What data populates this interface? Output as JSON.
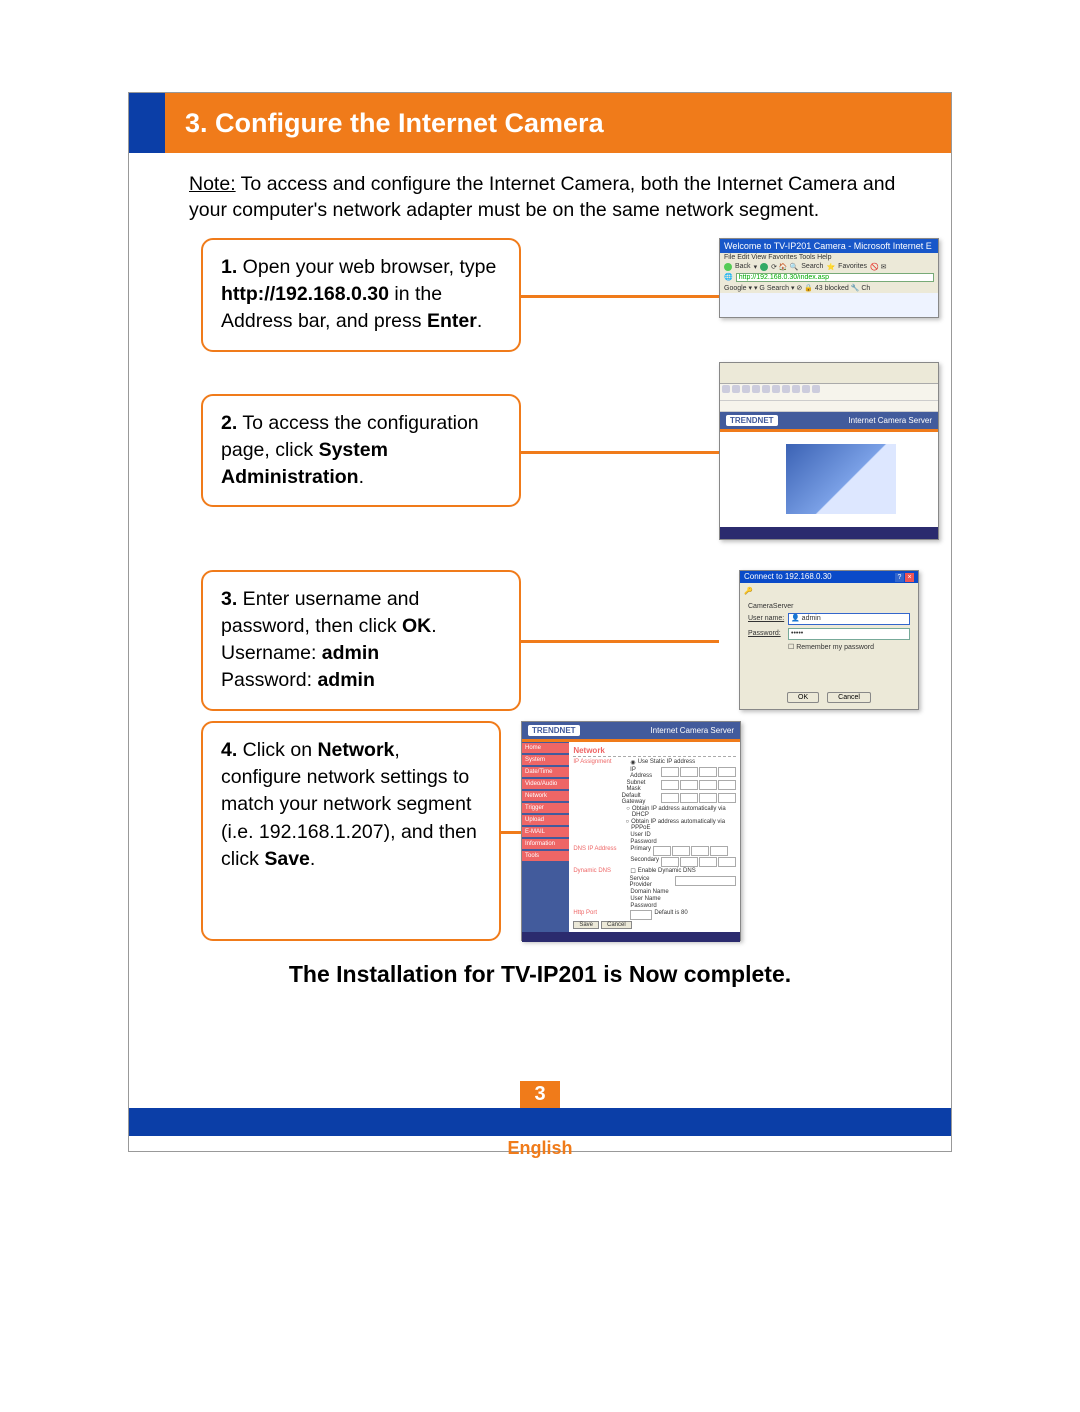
{
  "heading": "3. Configure the Internet Camera",
  "note": {
    "label": "Note:",
    "text": " To access and configure the Internet Camera, both the Internet Camera and your computer's network adapter must be on the same network segment."
  },
  "steps": {
    "s1": {
      "n": "1.",
      "a": " Open your web browser, type ",
      "b": "http://192.168.0.30",
      "c": " in the Address bar, and press ",
      "d": "Enter",
      "e": "."
    },
    "s2": {
      "n": "2.",
      "a": " To access the configuration page, click ",
      "b": "System Administration",
      "c": "."
    },
    "s3": {
      "n": "3.",
      "a": " Enter username and password, then click ",
      "b": "OK",
      "c": ".",
      "ul": "Username: ",
      "uv": "admin",
      "pl": "Password: ",
      "pv": "admin"
    },
    "s4": {
      "n": "4.",
      "a": " Click on ",
      "b": "Network",
      "c": ", configure network settings to match your network segment (i.e. 192.168.1.207), and then click ",
      "d": "Save",
      "e": "."
    }
  },
  "shots": {
    "ie": {
      "title": "Welcome to TV-IP201 Camera - Microsoft Internet E",
      "menu": "File   Edit   View   Favorites   Tools   Help",
      "back": "Back",
      "search": "Search",
      "fav": "Favorites",
      "url": "http://192.168.0.30/index.asp",
      "googlebar": "Google ▾            ▾  G Search ▾  ⊘  🔒 43 blocked  🔧 Ch"
    },
    "brand": {
      "logo": "TRENDNET",
      "right": "Internet Camera Server"
    },
    "login": {
      "title": "Connect to 192.168.0.30",
      "server": "CameraServer",
      "user_lab": "User name:",
      "user_val": "admin",
      "pass_lab": "Password:",
      "pass_val": "•••••",
      "remember": "Remember my password",
      "ok": "OK",
      "cancel": "Cancel"
    },
    "net": {
      "menu": [
        "Home",
        "System",
        "Date/Time",
        "Video/Audio",
        "Network",
        "Trigger",
        "Upload",
        "E-MAIL",
        "Information",
        "Tools"
      ],
      "header": "Network",
      "ipa_lab": "IP Assignment",
      "radio1": "Use Static IP address",
      "rows": [
        "IP Address",
        "Subnet Mask",
        "Default Gateway"
      ],
      "radio2": "Obtain IP address automatically via DHCP",
      "radio3": "Obtain IP address automatically via PPPoE",
      "uid": "User ID",
      "pwd": "Password",
      "dns_lab": "DNS IP Address",
      "dns1": "Primary",
      "dns2": "Secondary",
      "ddns_lab": "Dynamic DNS",
      "ddns_chk": "Enable Dynamic DNS",
      "sp": "Service Provider",
      "dn": "Domain Name",
      "un": "User Name",
      "pw": "Password",
      "http_lab": "Http Port",
      "http_def": "Default is 80",
      "save": "Save",
      "cancel": "Cancel"
    }
  },
  "complete": "The Installation for TV-IP201 is Now complete.",
  "footer": {
    "page": "3",
    "lang": "English"
  }
}
